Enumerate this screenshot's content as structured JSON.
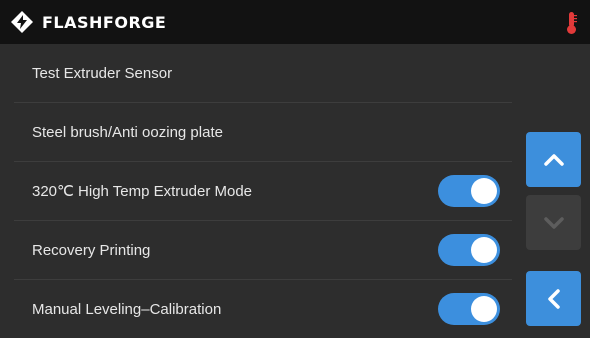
{
  "header": {
    "brand": "FLASHFORGE",
    "logo_icon": "flashforge-logo-icon",
    "status_icon": "thermometer-icon",
    "status_icon_color": "#e23a3a"
  },
  "settings": {
    "rows": [
      {
        "label": "Test Extruder Sensor",
        "has_toggle": false
      },
      {
        "label": "Steel brush/Anti oozing plate",
        "has_toggle": false
      },
      {
        "label": "320℃ High Temp Extruder Mode",
        "has_toggle": true,
        "toggle_on": true
      },
      {
        "label": "Recovery Printing",
        "has_toggle": true,
        "toggle_on": true
      },
      {
        "label": "Manual Leveling–Calibration",
        "has_toggle": true,
        "toggle_on": true
      }
    ]
  },
  "nav": {
    "scroll_up_icon": "chevron-up-icon",
    "scroll_down_icon": "chevron-down-icon",
    "scroll_down_enabled": false,
    "back_icon": "chevron-left-icon"
  },
  "colors": {
    "accent": "#3d8fdc",
    "background": "#2d2d2d",
    "header": "#121212",
    "disabled_button": "#3d3d3d"
  }
}
